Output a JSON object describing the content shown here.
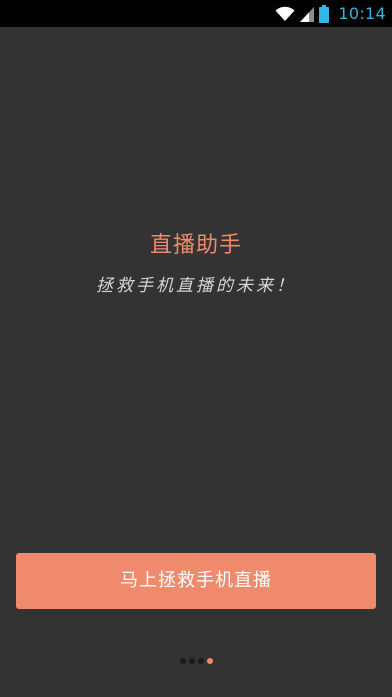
{
  "status_bar": {
    "time": "10:14",
    "icons": [
      "wifi-icon",
      "signal-icon",
      "battery-icon"
    ]
  },
  "intro": {
    "title": "直播助手",
    "subtitle": "拯救手机直播的未来！"
  },
  "action": {
    "button_label": "马上拯救手机直播"
  },
  "pager": {
    "total_pages": 4,
    "current_page": 4
  },
  "colors": {
    "background": "#333333",
    "accent": "#f08a6d",
    "status_time": "#33b5e5"
  }
}
